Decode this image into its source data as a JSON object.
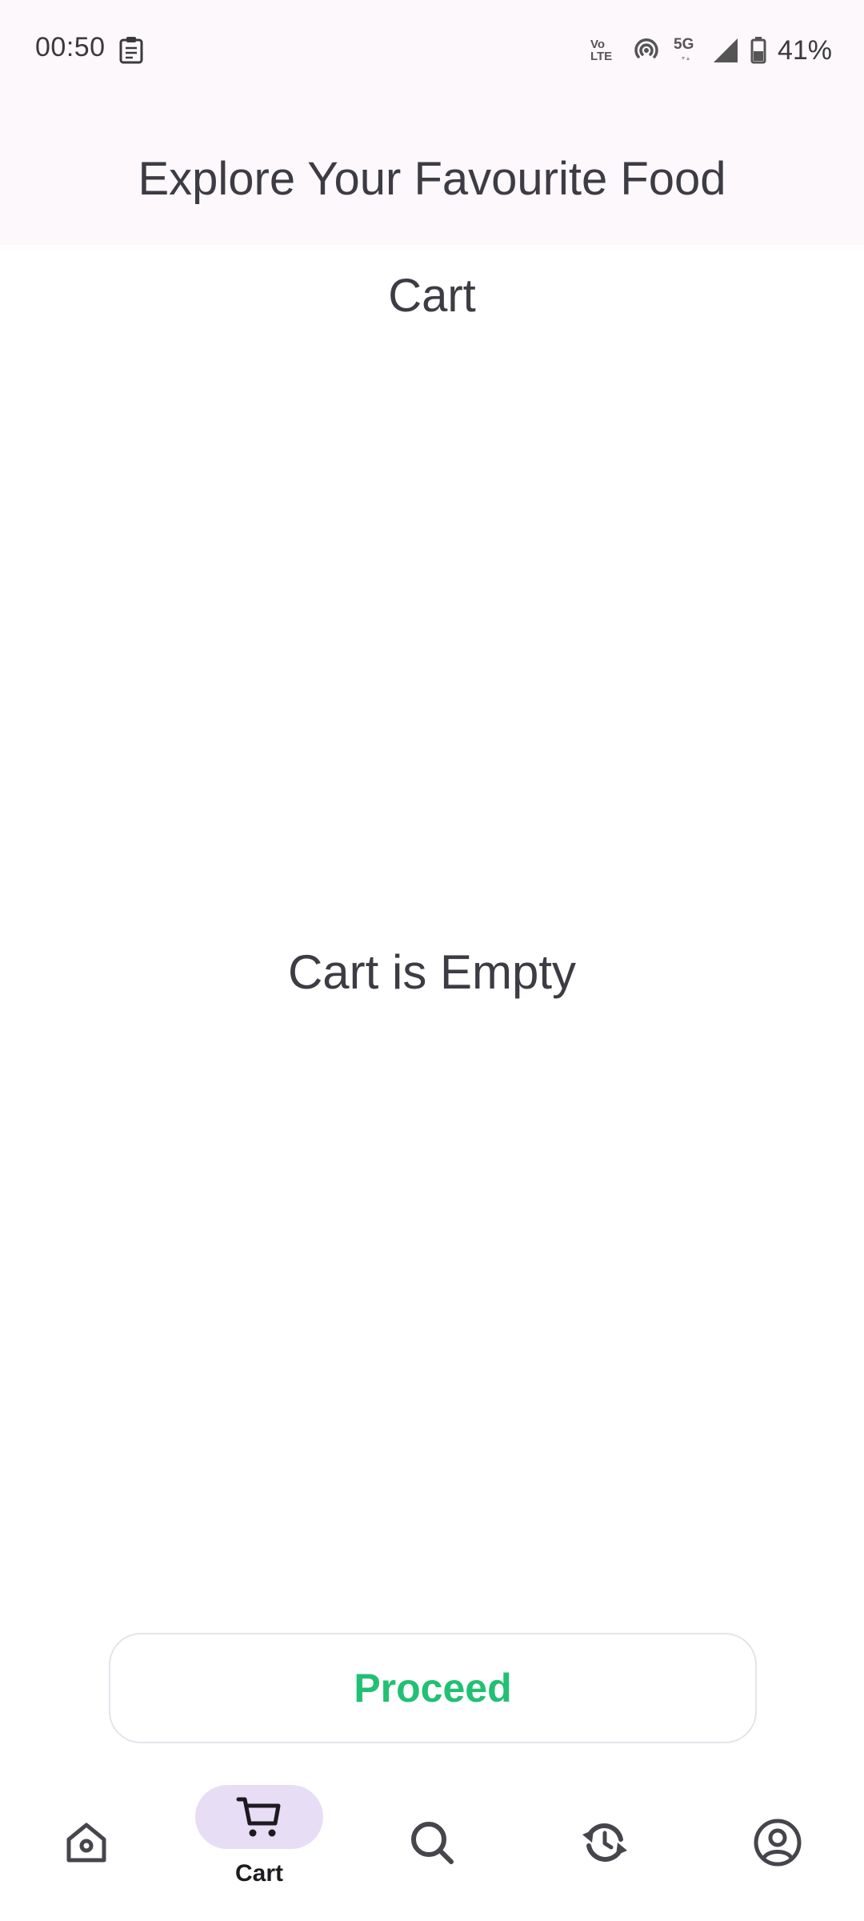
{
  "status_bar": {
    "time": "00:50",
    "volte_top": "Vo",
    "volte_bottom": "LTE",
    "network": "5G",
    "battery": "41%"
  },
  "app_bar": {
    "title": "Explore Your Favourite Food"
  },
  "page": {
    "heading": "Cart",
    "empty_message": "Cart is Empty"
  },
  "actions": {
    "proceed_label": "Proceed"
  },
  "colors": {
    "accent_green": "#22c073",
    "nav_pill": "#e7def6",
    "top_background": "#fdf8fc"
  },
  "bottom_nav": {
    "items": [
      {
        "icon": "home-icon",
        "label": ""
      },
      {
        "icon": "cart-icon",
        "label": "Cart",
        "active": true
      },
      {
        "icon": "search-icon",
        "label": ""
      },
      {
        "icon": "history-icon",
        "label": ""
      },
      {
        "icon": "profile-icon",
        "label": ""
      }
    ]
  }
}
